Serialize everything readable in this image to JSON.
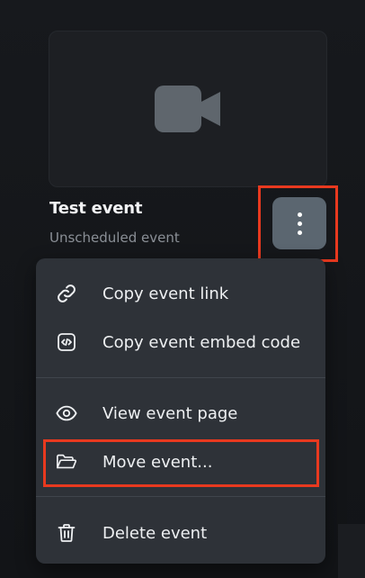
{
  "event": {
    "title": "Test event",
    "subtitle": "Unscheduled event",
    "thumbnail_icon": "video-camera-icon"
  },
  "actions_button": {
    "icon": "more-vertical-icon",
    "highlighted": true
  },
  "menu": {
    "groups": [
      [
        {
          "label": "Copy event link",
          "icon": "link-icon"
        },
        {
          "label": "Copy event embed code",
          "icon": "code-icon"
        }
      ],
      [
        {
          "label": "View event page",
          "icon": "eye-icon"
        },
        {
          "label": "Move event...",
          "icon": "folder-open-icon",
          "highlighted": true
        }
      ],
      [
        {
          "label": "Delete event",
          "icon": "trash-icon"
        }
      ]
    ]
  },
  "colors": {
    "background": "#14161a",
    "menu_background": "#2e3238",
    "highlight_outline": "#e8391f",
    "kebab_button": "#5b6670"
  }
}
